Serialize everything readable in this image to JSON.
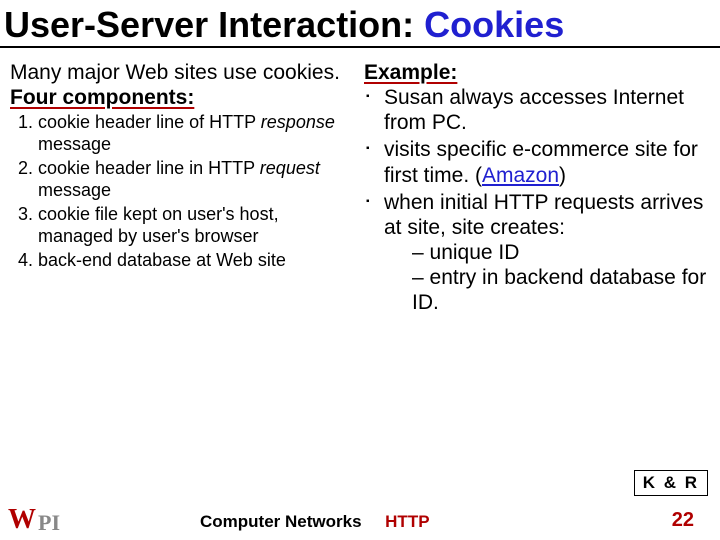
{
  "title": {
    "part1": "User-Server Interaction:",
    "part2_space": " ",
    "part3": "Cookies"
  },
  "left": {
    "lead1": "Many major Web sites use cookies.",
    "four_label": "Four components:",
    "items": [
      {
        "pre": "cookie header line of HTTP ",
        "it": "response",
        "post": " message"
      },
      {
        "pre": "cookie header line in HTTP ",
        "it": "request",
        "post": " message"
      },
      {
        "pre": "cookie file kept on user's host, managed by user's browser",
        "it": "",
        "post": ""
      },
      {
        "pre": "back-end database at Web site",
        "it": "",
        "post": ""
      }
    ]
  },
  "right": {
    "example_label": "Example:",
    "b1": "Susan always accesses Internet from PC.",
    "b2_pre": "visits specific e-commerce site for first time. (",
    "b2_link": "Amazon",
    "b2_post": ")",
    "b3": "when initial HTTP requests arrives at site, site creates:",
    "d1": "unique ID",
    "d2": "entry in backend database for ID."
  },
  "footer": {
    "center_black": "Computer Networks",
    "center_red": "HTTP",
    "page": "22",
    "kr": "K & R",
    "logo_w": "W",
    "logo_pi": "PI"
  }
}
